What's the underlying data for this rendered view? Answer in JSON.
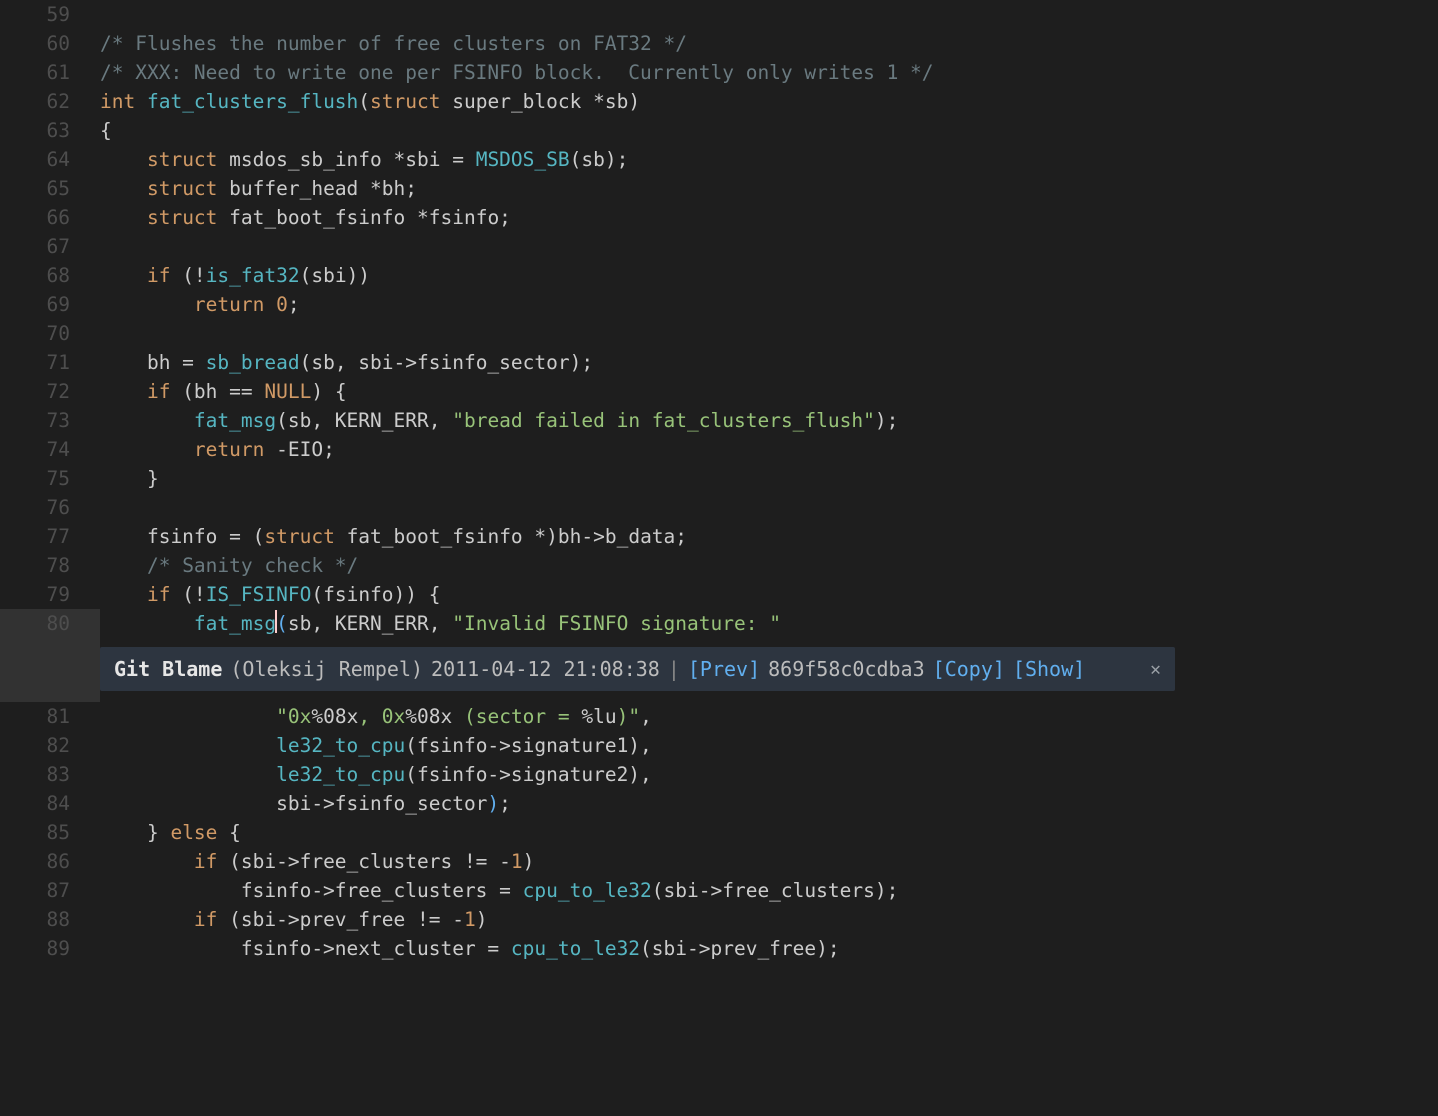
{
  "gutter_hl_line": 80,
  "lines": [
    {
      "n": 59,
      "tokens": []
    },
    {
      "n": 60,
      "tokens": [
        {
          "t": "/* Flushes the number of free clusters on FAT32 */",
          "c": "c-comment"
        }
      ]
    },
    {
      "n": 61,
      "tokens": [
        {
          "t": "/* XXX: Need to write one per FSINFO block.  Currently only writes 1 */",
          "c": "c-comment"
        }
      ]
    },
    {
      "n": 62,
      "tokens": [
        {
          "t": "int ",
          "c": "c-keyword"
        },
        {
          "t": "fat_clusters_flush",
          "c": "c-func"
        },
        {
          "t": "("
        },
        {
          "t": "struct",
          "c": "c-keyword"
        },
        {
          "t": " super_block "
        },
        {
          "t": "*"
        },
        {
          "t": "sb)"
        }
      ]
    },
    {
      "n": 63,
      "tokens": [
        {
          "t": "{"
        }
      ]
    },
    {
      "n": 64,
      "tokens": [
        {
          "t": "    "
        },
        {
          "t": "struct",
          "c": "c-keyword"
        },
        {
          "t": " msdos_sb_info *sbi = "
        },
        {
          "t": "MSDOS_SB",
          "c": "c-func"
        },
        {
          "t": "(sb);"
        }
      ]
    },
    {
      "n": 65,
      "tokens": [
        {
          "t": "    "
        },
        {
          "t": "struct",
          "c": "c-keyword"
        },
        {
          "t": " buffer_head *bh;"
        }
      ]
    },
    {
      "n": 66,
      "tokens": [
        {
          "t": "    "
        },
        {
          "t": "struct",
          "c": "c-keyword"
        },
        {
          "t": " fat_boot_fsinfo *fsinfo;"
        }
      ]
    },
    {
      "n": 67,
      "tokens": []
    },
    {
      "n": 68,
      "tokens": [
        {
          "t": "    "
        },
        {
          "t": "if",
          "c": "c-keyword"
        },
        {
          "t": " (!"
        },
        {
          "t": "is_fat32",
          "c": "c-func"
        },
        {
          "t": "(sbi))"
        }
      ]
    },
    {
      "n": 69,
      "tokens": [
        {
          "t": "        "
        },
        {
          "t": "return",
          "c": "c-keyword"
        },
        {
          "t": " "
        },
        {
          "t": "0",
          "c": "c-num"
        },
        {
          "t": ";"
        }
      ]
    },
    {
      "n": 70,
      "tokens": []
    },
    {
      "n": 71,
      "tokens": [
        {
          "t": "    bh = "
        },
        {
          "t": "sb_bread",
          "c": "c-func"
        },
        {
          "t": "(sb, sbi->fsinfo_sector);"
        }
      ]
    },
    {
      "n": 72,
      "tokens": [
        {
          "t": "    "
        },
        {
          "t": "if",
          "c": "c-keyword"
        },
        {
          "t": " (bh == "
        },
        {
          "t": "NULL",
          "c": "c-null"
        },
        {
          "t": ") {"
        }
      ]
    },
    {
      "n": 73,
      "tokens": [
        {
          "t": "        "
        },
        {
          "t": "fat_msg",
          "c": "c-func"
        },
        {
          "t": "(sb, KERN_ERR, "
        },
        {
          "t": "\"bread failed in fat_clusters_flush\"",
          "c": "c-string"
        },
        {
          "t": ");"
        }
      ]
    },
    {
      "n": 74,
      "tokens": [
        {
          "t": "        "
        },
        {
          "t": "return",
          "c": "c-keyword"
        },
        {
          "t": " -EIO;"
        }
      ]
    },
    {
      "n": 75,
      "tokens": [
        {
          "t": "    }"
        }
      ]
    },
    {
      "n": 76,
      "tokens": []
    },
    {
      "n": 77,
      "tokens": [
        {
          "t": "    fsinfo = ("
        },
        {
          "t": "struct",
          "c": "c-keyword"
        },
        {
          "t": " fat_boot_fsinfo *)bh->b_data;"
        }
      ]
    },
    {
      "n": 78,
      "tokens": [
        {
          "t": "    "
        },
        {
          "t": "/* Sanity check */",
          "c": "c-comment"
        }
      ]
    },
    {
      "n": 79,
      "tokens": [
        {
          "t": "    "
        },
        {
          "t": "if",
          "c": "c-keyword"
        },
        {
          "t": " (!"
        },
        {
          "t": "IS_FSINFO",
          "c": "c-func"
        },
        {
          "t": "(fsinfo)) {"
        }
      ]
    },
    {
      "n": 80,
      "tokens": [
        {
          "t": "        "
        },
        {
          "t": "fat_msg",
          "c": "c-func"
        },
        {
          "t": "(",
          "c": "c-op",
          "cursor_before": true
        },
        {
          "t": "sb, KERN_ERR, "
        },
        {
          "t": "\"Invalid FSINFO signature: \"",
          "c": "c-string"
        }
      ]
    },
    {
      "n": 81,
      "tokens": [
        {
          "t": "               "
        },
        {
          "t": "\"0x",
          "c": "c-string"
        },
        {
          "t": "%08x"
        },
        {
          "t": ", 0x",
          "c": "c-string"
        },
        {
          "t": "%08x "
        },
        {
          "t": "(sector = ",
          "c": "c-string"
        },
        {
          "t": "%lu"
        },
        {
          "t": ")\"",
          "c": "c-string"
        },
        {
          "t": ","
        }
      ]
    },
    {
      "n": 82,
      "tokens": [
        {
          "t": "               "
        },
        {
          "t": "le32_to_cpu",
          "c": "c-func"
        },
        {
          "t": "(fsinfo->signature1),"
        }
      ]
    },
    {
      "n": 83,
      "tokens": [
        {
          "t": "               "
        },
        {
          "t": "le32_to_cpu",
          "c": "c-func"
        },
        {
          "t": "(fsinfo->signature2),"
        }
      ]
    },
    {
      "n": 84,
      "tokens": [
        {
          "t": "               sbi->fsinfo_sector"
        },
        {
          "t": ")",
          "c": "c-op"
        },
        {
          "t": ";"
        }
      ]
    },
    {
      "n": 85,
      "tokens": [
        {
          "t": "    } "
        },
        {
          "t": "else",
          "c": "c-keyword"
        },
        {
          "t": " {"
        }
      ]
    },
    {
      "n": 86,
      "tokens": [
        {
          "t": "        "
        },
        {
          "t": "if",
          "c": "c-keyword"
        },
        {
          "t": " (sbi->free_clusters != -"
        },
        {
          "t": "1",
          "c": "c-num"
        },
        {
          "t": ")"
        }
      ]
    },
    {
      "n": 87,
      "tokens": [
        {
          "t": "            fsinfo->free_clusters = "
        },
        {
          "t": "cpu_to_le32",
          "c": "c-func"
        },
        {
          "t": "(sbi->free_clusters);"
        }
      ]
    },
    {
      "n": 88,
      "tokens": [
        {
          "t": "        "
        },
        {
          "t": "if",
          "c": "c-keyword"
        },
        {
          "t": " (sbi->prev_free != -"
        },
        {
          "t": "1",
          "c": "c-num"
        },
        {
          "t": ")"
        }
      ]
    },
    {
      "n": 89,
      "tokens": [
        {
          "t": "            fsinfo->next_cluster = "
        },
        {
          "t": "cpu_to_le32",
          "c": "c-func"
        },
        {
          "t": "(sbi->prev_free);"
        }
      ]
    }
  ],
  "blame": {
    "title": "Git Blame",
    "author": "(Oleksij Rempel)",
    "timestamp": "2011-04-12 21:08:38",
    "sep": "|",
    "prev": "[Prev]",
    "hash": "869f58c0cdba3",
    "copy": "[Copy]",
    "show": "[Show]"
  }
}
